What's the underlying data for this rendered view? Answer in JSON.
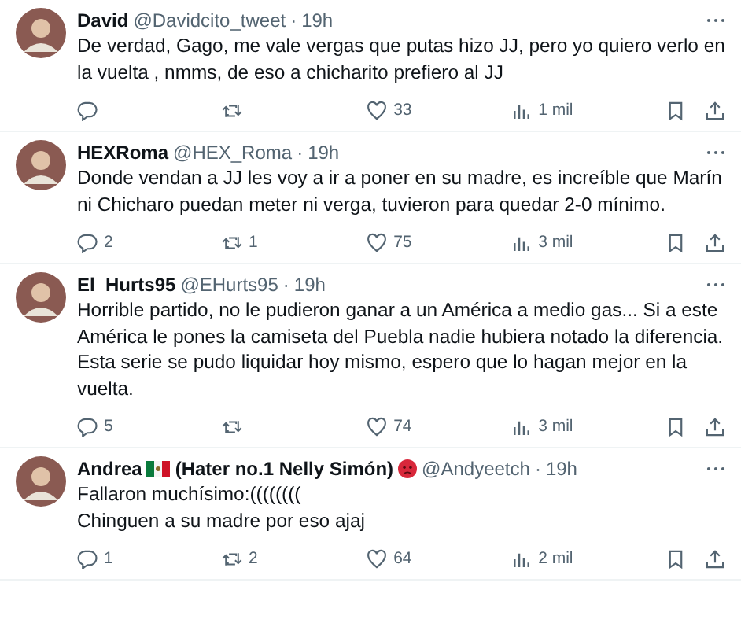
{
  "replies": [
    {
      "name": "David",
      "handle": "@Davidcito_tweet",
      "separator": "·",
      "time": "19h",
      "text": "De verdad, Gago, me vale vergas que putas hizo JJ, pero yo quiero verlo en la vuelta , nmms, de eso a chicharito prefiero al JJ",
      "stats": {
        "like": "33",
        "views": "1 mil"
      }
    },
    {
      "name": "HEXRoma",
      "handle": "@HEX_Roma",
      "separator": "·",
      "time": "19h",
      "text": "Donde vendan a JJ les voy a ir a poner en su madre, es increíble que Marín ni Chicharo puedan meter ni verga, tuvieron para quedar 2-0 mínimo.",
      "stats": {
        "reply": "2",
        "retweet": "1",
        "like": "75",
        "views": "3 mil"
      }
    },
    {
      "name": "El_Hurts95",
      "handle": "@EHurts95",
      "separator": "·",
      "time": "19h",
      "text": "Horrible partido, no le pudieron ganar a un América a medio gas... Si a este América le pones la camiseta del Puebla nadie hubiera notado la diferencia. Esta serie se pudo liquidar hoy mismo, espero que lo hagan mejor en la vuelta.",
      "stats": {
        "reply": "5",
        "like": "74",
        "views": "3 mil"
      }
    },
    {
      "name": "Andrea",
      "flag": true,
      "name_extra": "(Hater no.1 Nelly Simón)",
      "badge": true,
      "handle": "@Andyeetch",
      "separator": "·",
      "time": "19h",
      "text": "Fallaron muchísimo:((((((((\nChinguen a su madre por eso ajaj",
      "stats": {
        "reply": "1",
        "retweet": "2",
        "like": "64",
        "views": "2 mil"
      }
    }
  ]
}
